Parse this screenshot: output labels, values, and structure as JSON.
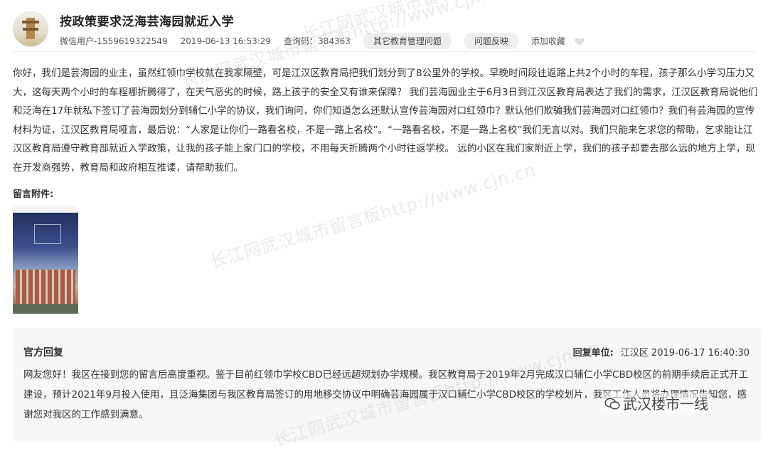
{
  "post": {
    "title": "按政策要求泛海芸海园就近入学",
    "user": "微信用户-1559619322549",
    "datetime": "2019-06-13 16:53:29",
    "query_code": "查询码：384363",
    "category": "其它教育管理问题",
    "feedback": "问题反映",
    "favorite": "添加收藏",
    "body": "你好，我们是芸海园的业主，虽然红领巾学校就在我家隔壁，可是江汉区教育局把我们划分到了8公里外的学校。早晚时间段往返路上共2个小时的车程，孩子那么小学习压力又大，这每天两个小时的车程哪折腾得了，在天气恶劣的时候，路上孩子的安全又有谁来保障？ 我们芸海园业主于6月3日到江汉区教育局表达了我们的需求，江汉区教育局说他们和泛海在17年就私下签订了芸海园划分到辅仁小学的协议，我们询问，你们知道怎么还默认宣传芸海园对口红领巾？默认他们欺骗我们芸海园对口红领巾？我们有芸海园的宣传材料为证，江汉区教育局哑言，最后说：“人家是让你们一路看名校，不是一路上名校”。“一路看名校，不是一路上名校”我们无言以对。我们只能来乞求您的帮助，乞求能让江汉区教育局遵守教育部就近入学政策，让我的孩子能上家门口的学校，不用每天折腾两个小时往返学校。 远的小区在我们家附近上学，我们的孩子却要去那么远的地方上学，现在开发商强势，教育局和政府相互推诿，请帮助我们。",
    "attachment_label": "留言附件:"
  },
  "reply": {
    "title": "官方回复",
    "unit_label": "回复单位:",
    "unit_value": "江汉区 2019-06-17 16:40:30",
    "body": "网友您好！我区在接到您的留言后高度重视。鉴于目前红领巾学校CBD已经远超规划办学规模。我区教育局于2019年2月完成汉口辅仁小学CBD校区的前期手续后正式开工建设，预计2021年9月投入使用，且泛海集团与我区教育局签订的用地移交协议中明确芸海园属于汉口辅仁小学CBD校区的学校划片，我区工作人员将办理情况告知您，感谢您对我区的工作感到满意。"
  },
  "watermarks": [
    "长江网武汉城市留言板http://www.cjn.cn",
    "长江网武汉城市留言板http://www.cjn.cn",
    "长江网武汉城市留言板http://www.cjn.cn",
    "长江网武汉城市留言板http://www.cjn.cn"
  ],
  "overlay_badge": "武汉楼市一线"
}
